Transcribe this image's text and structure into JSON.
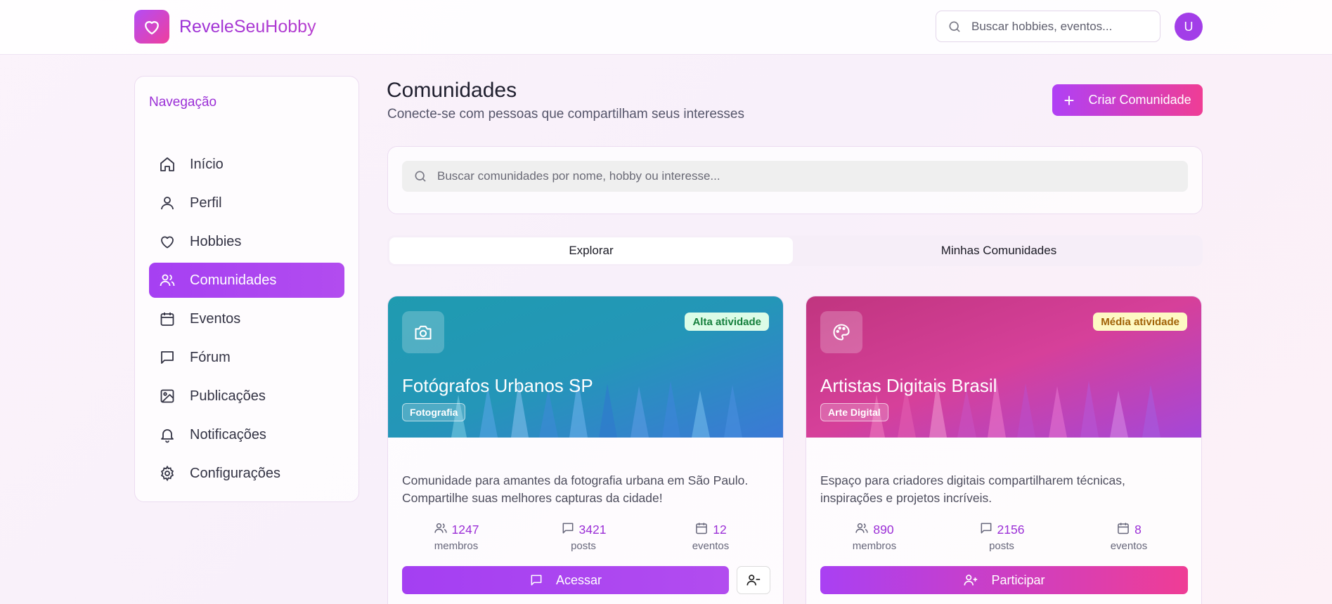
{
  "header": {
    "brand": "ReveleSeuHobby",
    "search_placeholder": "Buscar hobbies, eventos...",
    "avatar_initial": "U"
  },
  "sidebar": {
    "title": "Navegação",
    "items": [
      {
        "label": "Início",
        "icon": "home-icon"
      },
      {
        "label": "Perfil",
        "icon": "user-icon"
      },
      {
        "label": "Hobbies",
        "icon": "heart-icon"
      },
      {
        "label": "Comunidades",
        "icon": "users-icon",
        "active": true
      },
      {
        "label": "Eventos",
        "icon": "calendar-icon"
      },
      {
        "label": "Fórum",
        "icon": "message-square-icon"
      },
      {
        "label": "Publicações",
        "icon": "image-icon"
      },
      {
        "label": "Notificações",
        "icon": "bell-icon"
      },
      {
        "label": "Configurações",
        "icon": "gear-icon"
      }
    ]
  },
  "main": {
    "title": "Comunidades",
    "subtitle": "Conecte-se com pessoas que compartilham seus interesses",
    "create_label": "Criar Comunidade",
    "search_placeholder": "Buscar comunidades por nome, hobby ou interesse...",
    "tabs": [
      {
        "label": "Explorar",
        "active": true
      },
      {
        "label": "Minhas Comunidades",
        "active": false
      }
    ]
  },
  "communities": [
    {
      "name": "Fotógrafos Urbanos SP",
      "category": "Fotografia",
      "activity": "Alta atividade",
      "icon": "camera-icon",
      "description": "Comunidade para amantes da fotografia urbana em São Paulo. Compartilhe suas melhores capturas da cidade!",
      "members": "1247",
      "posts": "3421",
      "events": "12",
      "members_label": "membros",
      "posts_label": "posts",
      "events_label": "eventos",
      "action_label": "Acessar",
      "joined": true
    },
    {
      "name": "Artistas Digitais Brasil",
      "category": "Arte Digital",
      "activity": "Média atividade",
      "icon": "palette-icon",
      "description": "Espaço para criadores digitais compartilharem técnicas, inspirações e projetos incríveis.",
      "members": "890",
      "posts": "2156",
      "events": "8",
      "members_label": "membros",
      "posts_label": "posts",
      "events_label": "eventos",
      "action_label": "Participar",
      "joined": false
    }
  ],
  "colors": {
    "primary": "#a640f2",
    "accent": "#ef3d95",
    "high_activity_bg": "#dcfce7",
    "high_activity_text": "#15803d",
    "medium_activity_bg": "#fef9c3",
    "medium_activity_text": "#a16207"
  }
}
